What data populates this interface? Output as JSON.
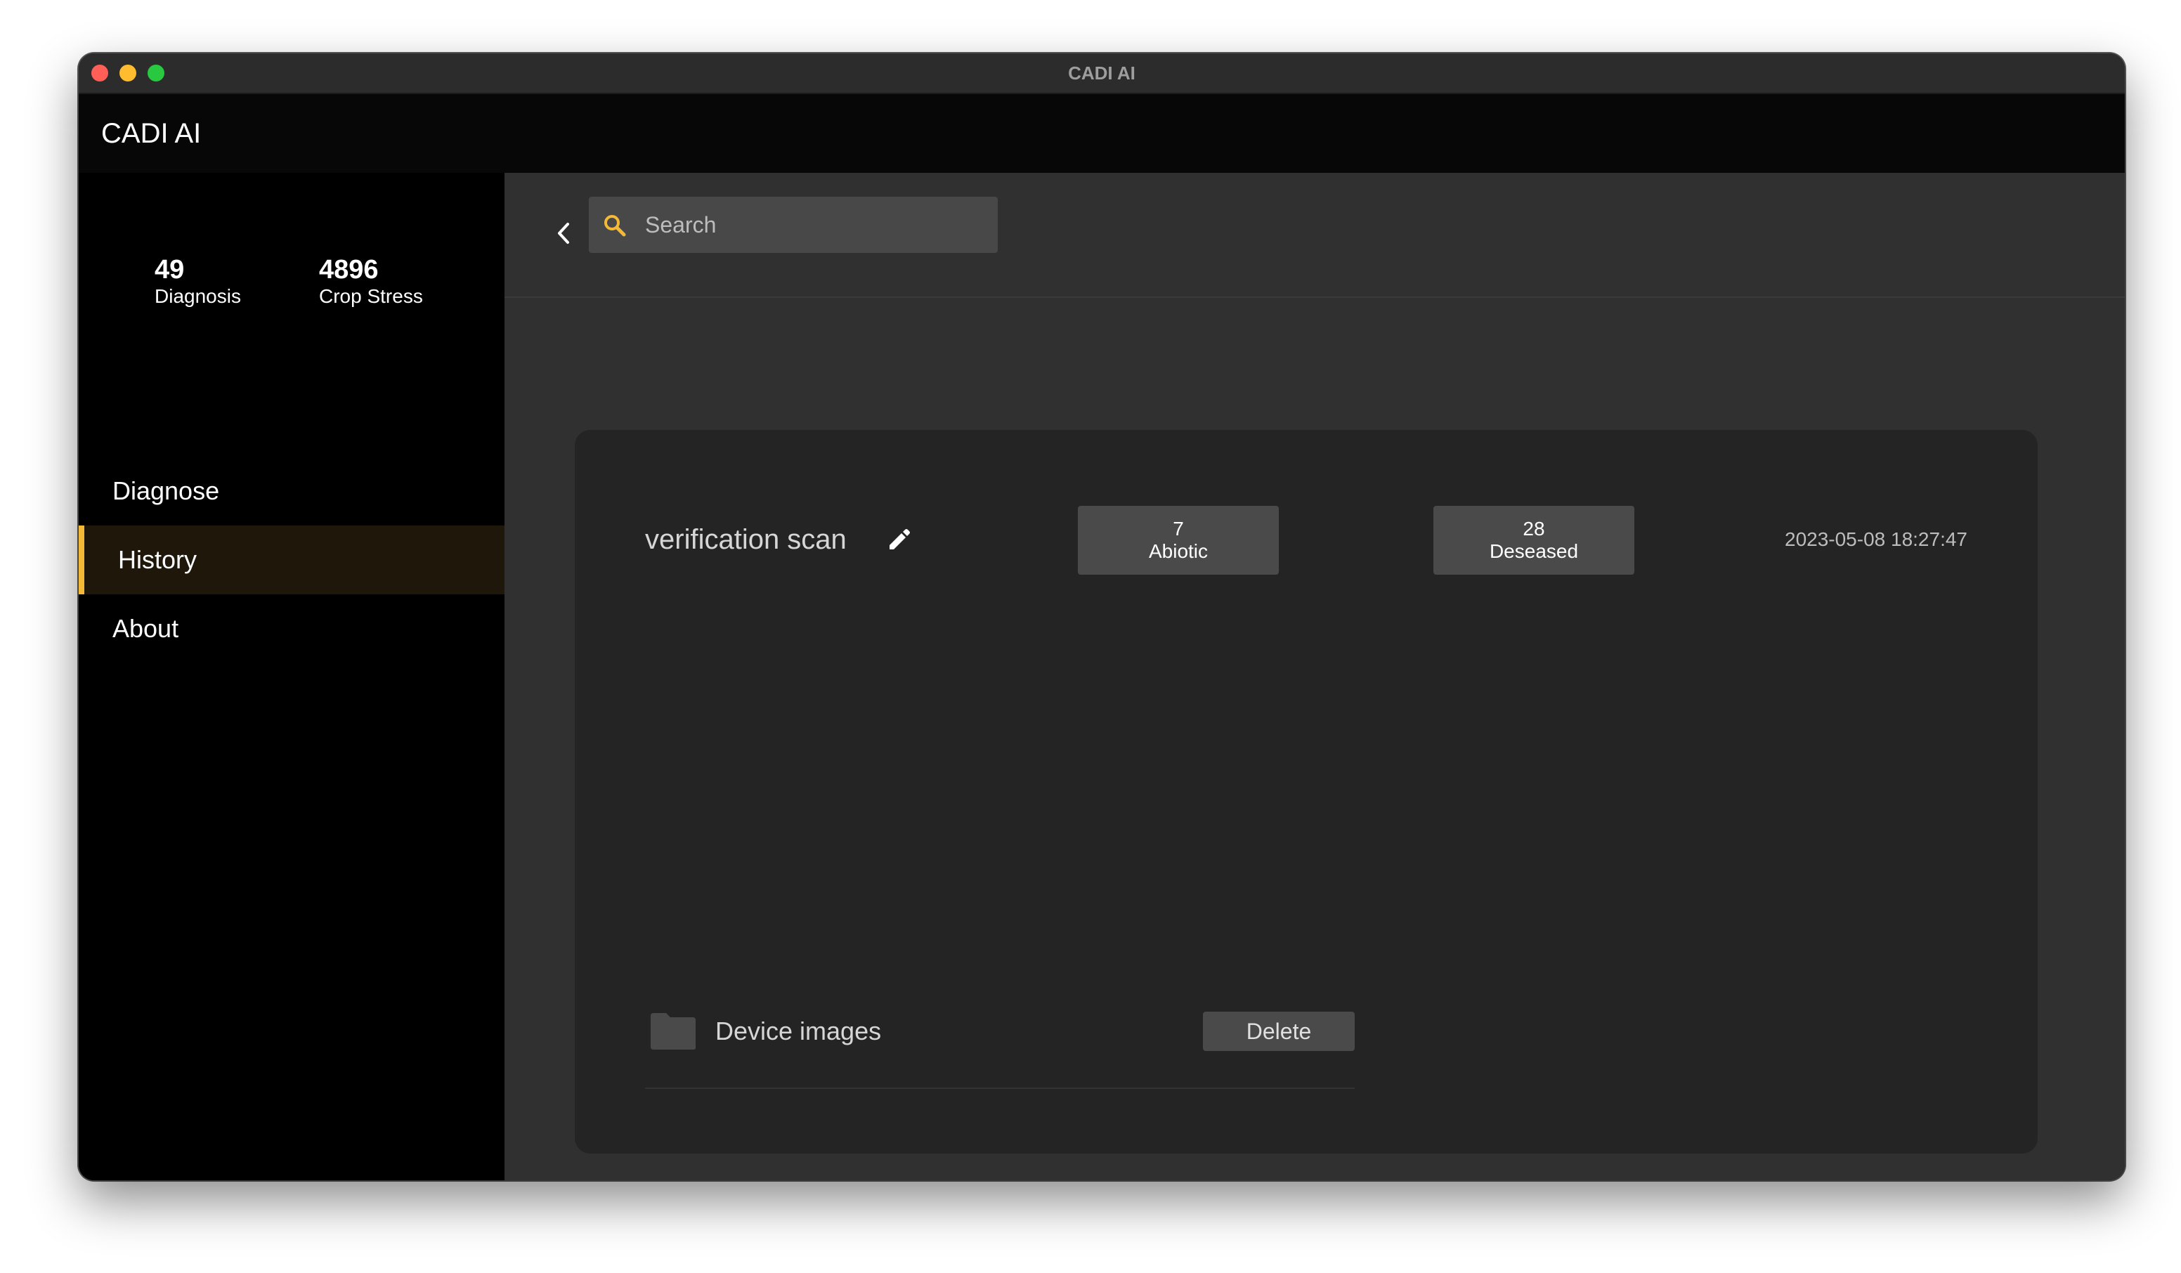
{
  "window": {
    "title": "CADI AI"
  },
  "appbar": {
    "title": "CADI AI"
  },
  "stats": {
    "diagnosis": {
      "value": "49",
      "label": "Diagnosis"
    },
    "crop_stress": {
      "value": "4896",
      "label": "Crop Stress"
    }
  },
  "nav": {
    "items": [
      {
        "label": "Diagnose",
        "selected": false
      },
      {
        "label": "History",
        "selected": true
      },
      {
        "label": "About",
        "selected": false
      }
    ]
  },
  "search": {
    "placeholder": "Search",
    "value": "",
    "icon": "search-icon"
  },
  "scan": {
    "title": "verification scan",
    "abiotic": {
      "count": "7",
      "label": "Abiotic"
    },
    "diseased": {
      "count": "28",
      "label": "Deseased"
    },
    "timestamp": "2023-05-08 18:27:47"
  },
  "files": [
    {
      "label": "Device images",
      "icon": "folder-icon",
      "action_label": "Delete"
    }
  ],
  "colors": {
    "accent": "#f4b935",
    "sidebar_bg": "#000000",
    "main_bg": "#303030",
    "card_bg": "#242424",
    "button_bg": "#4a4a4a",
    "selected_nav_bg": "#1e170a"
  }
}
